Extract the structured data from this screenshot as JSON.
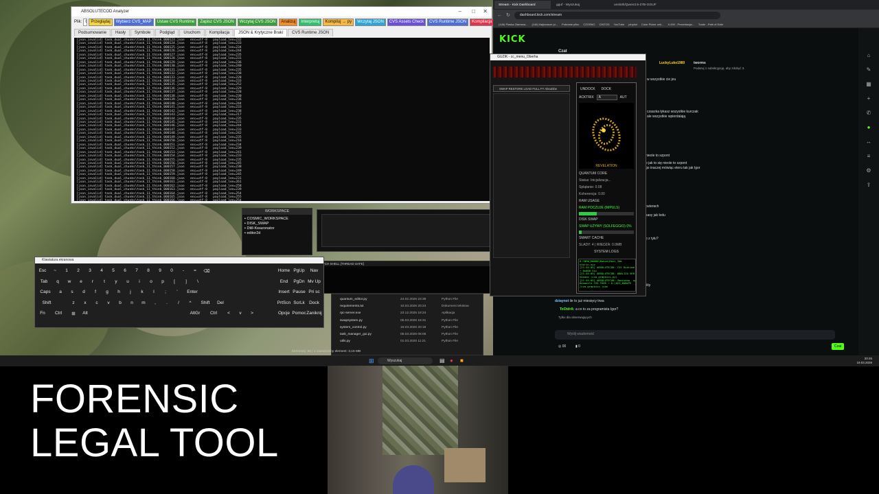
{
  "analyzer": {
    "title": "ABSOLUTECOD Analyzer",
    "file_label": "Plik:",
    "file_path": "ONOUT/cvs_graphics.py",
    "toolbar": [
      "Przeglądaj",
      "Wybierz CVS_MAP",
      "Ustaw CVS Runtime",
      "Zapisz CVS JSON",
      "Wczytaj CVS JSON",
      "Analizuj",
      "Interpretuj",
      "Kompiluj → py",
      "Wczytaj JSON",
      "CVS Assets Check",
      "CVS Runtime JSON",
      "Kompilacja Krytyczna 100%"
    ],
    "toolbar_colors": [
      "#f5d442",
      "#4f6dd9",
      "#3a9e3a",
      "#3a9e3a",
      "#3a9e3a",
      "#f28c28",
      "#2fbf6f",
      "#f5b942",
      "#2fa4d9",
      "#6a4fd9",
      "#4f6dd9",
      "#e0334d"
    ],
    "tabs": [
      "Podsumowanie",
      "Hasły",
      "Symbole",
      "Podgląd",
      "Uruchom",
      "Kompilacja",
      "JSON & Krytyczne Braki",
      "CVS Runtime JSON"
    ],
    "active_tab": 6,
    "log_start": 123,
    "log_end": 166,
    "log_prefix": "[json_invalid] task_dual_chunks\\task_11_think_",
    "log_mid": ".json   enc=utf-8   payload_len=",
    "payload_lens": [
      232,
      233,
      234,
      244,
      235,
      231,
      236,
      240,
      235,
      238,
      228,
      233,
      252,
      229,
      228,
      230,
      236,
      244,
      233,
      238,
      217,
      235,
      231,
      244,
      233,
      242,
      235,
      216,
      234,
      239,
      241,
      233,
      235,
      245,
      238,
      249,
      245,
      231,
      261,
      258,
      239,
      254,
      255,
      254
    ]
  },
  "workspace": {
    "header": "WORKSPACE",
    "items": [
      "COSMIC_WORKSPACE",
      "DISK_SWAP",
      "Dtill-Kwazonator",
      "editor2d"
    ]
  },
  "shell": {
    "label": "TCH SHELL [THREAD SAFE]"
  },
  "keyboard": {
    "title": "Klawiatura ekranowa",
    "rows": [
      [
        "Esc",
        "~",
        "1",
        "2",
        "3",
        "4",
        "5",
        "6",
        "7",
        "8",
        "9",
        "0",
        "-",
        "=",
        "⌫",
        "Home",
        "PgUp",
        "Nav"
      ],
      [
        "Tab",
        "q",
        "w",
        "e",
        "r",
        "t",
        "y",
        "u",
        "i",
        "o",
        "p",
        "[",
        "]",
        "\\",
        "",
        "End",
        "PgDn",
        "Mv Up"
      ],
      [
        "Caps",
        "a",
        "s",
        "d",
        "f",
        "g",
        "h",
        "j",
        "k",
        "l",
        ";",
        "'",
        "Enter",
        "",
        "",
        "Insert",
        "Pause",
        "Pri sc"
      ],
      [
        "Shift",
        "",
        "z",
        "x",
        "c",
        "v",
        "b",
        "n",
        "m",
        ",",
        ".",
        "/",
        "^",
        "Shift",
        "Del",
        "PrtScn",
        "ScrLk",
        "Dock"
      ],
      [
        "Fn",
        "Ctrl",
        "⊞",
        "Alt",
        "",
        "",
        "",
        "",
        "",
        "",
        "AltGr",
        "Ctrl",
        "<",
        "v",
        ">",
        "Opcje",
        "Pomoc",
        "Zaniknij"
      ]
    ]
  },
  "explorer": {
    "files": [
      {
        "name": "quantum_editor.py",
        "date": "24.02.2026 23:39",
        "type": "Python File"
      },
      {
        "name": "requirements.txt",
        "date": "10.03.2026 20:24",
        "type": "Dokument tekstow."
      },
      {
        "name": "rpc-server.exe",
        "date": "23.12.2025 18:24",
        "type": "Aplikacja"
      },
      {
        "name": "swapsystem.py",
        "date": "05.03.2026 16:31",
        "type": "Python File"
      },
      {
        "name": "system_control.py",
        "date": "16.03.2026 20:18",
        "type": "Python File"
      },
      {
        "name": "task_manager_gui.py",
        "date": "05.03.2026 06:05",
        "type": "Python File"
      },
      {
        "name": "utils.py",
        "date": "01.03.2026 11:21",
        "type": "Python File"
      }
    ],
    "status": "Elementy: 85  |  1 zaznaczony element: 3,15 MB"
  },
  "browser": {
    "tabs": [
      "Stream - Kick Dashboard",
      "gguf - Wyszukaj",
      "unsloth/Qwen3.5-27B-GGUF"
    ],
    "url": "dashboard.kick.com/stream",
    "bookmarks": [
      "(146) Piaska Zlamana...",
      "(146) Najnowsze pi...",
      "Pobranie pliku",
      "CZOSNO",
      "CINTOS",
      "YouTube",
      "pinpilot",
      "Color Picker onli...",
      "X-KW - Prezentacja...",
      "Trade - Path of Exile"
    ],
    "logo": "KICK",
    "chat_title": "Czat",
    "user": "LuckyLuke1980",
    "user2": "tworms",
    "sub_notice": "Podaruj 1 subskrypcję, aby zdobyć 3.",
    "chat_lines": [
      "w wszystkie cie jeu",
      "czaszka łykasz wszystkie kurczak",
      "ale wszystkie wpierdalają",
      "nieole to szpont",
      "o jak to się nieole to szpont",
      "go inaczej mówiąc eteru tak jak Igor",
      "puterach",
      "kasy jak lodu",
      "o z tyłu?",
      "liity"
    ],
    "chat_bottom1_user": "dziaynot",
    "chat_bottom1_text": "ile to już miesięcy trwa",
    "chat_bottom2_user": "ToOtdrA:",
    "chat_bottom2_text": "a co to za programista Igor?",
    "only_followers": "Tylko dla obserwujących",
    "input_placeholder": "Wyślij wiadomość",
    "viewers": "00",
    "likes": "0",
    "chat_button": "Czat",
    "brand_color": "#53fc18"
  },
  "overlay": {
    "title": "GUZIK - cc_menu_Oberha",
    "buttons": "SWAP   RESTORE   LOAD FULL   FY AbsoDbe",
    "panel_tabs": [
      "UNDOCK",
      "DOCK"
    ],
    "mode": "ACKTRIX",
    "mode_value": "A",
    "mode_flag": "AUT",
    "artwork_label": "REVELATION",
    "quantum": "QUANTUM CORE",
    "status": "Status: Inicjalizacja...",
    "splatanie": "Splątanie: 0.08",
    "koherencja": "Koherencja: 0.00",
    "ram": "RAM USAGE",
    "ram_line": "RAM POCZUJE (IMPULS)",
    "ram_fill": 0.32,
    "disk": "DISK SWAP",
    "disk_line": "SWAP UŻYWY (SOLFEGGIO) 0%",
    "disk_fill": 0.05,
    "cache": "SMART CACHE",
    "cache_line": "SLADY: 4 | WIEDZA: 0.0MB",
    "syslog_title": "SYSTEM LOGS",
    "syslog": "0:\\NEW_KWADO\\Kwazo\\Kazi_IWe\nsterin.xyz\n[21:44:05] ABSOLUTECOD: CVS Runtime\n→ 0x000 Ssi\n[21:44:05] ABSOLUTECOD: ANALIZA SKR\nnOzone (cva_graphics.py)\n[21:44:05] ABSOLUTECOD: Zapisano  sp\nKanaeile CVS TKOR → 0:\\OVI_KONUTE\n/cva_graphics.json"
  },
  "taskbar": {
    "search": "Wyszukaj",
    "time": "20:45",
    "date": "19.03.2026"
  },
  "caption": {
    "line1": "FORENSIC",
    "line2": "LEGAL TOOL"
  }
}
